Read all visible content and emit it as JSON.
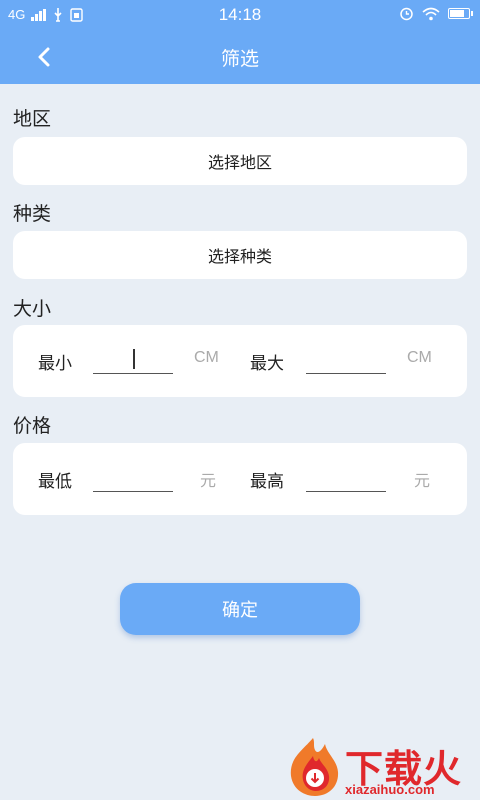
{
  "status_bar": {
    "network": "4G",
    "time": "14:18",
    "icons": [
      "signal-icon",
      "usb-icon",
      "sim-icon",
      "alarm-icon",
      "wifi-icon",
      "battery-icon"
    ]
  },
  "header": {
    "title": "筛选",
    "back_icon": "chevron-left-icon"
  },
  "region": {
    "label": "地区",
    "button": "选择地区"
  },
  "category": {
    "label": "种类",
    "button": "选择种类"
  },
  "size": {
    "label": "大小",
    "min_label": "最小",
    "max_label": "最大",
    "unit": "CM",
    "min_value": "",
    "max_value": ""
  },
  "price": {
    "label": "价格",
    "min_label": "最低",
    "max_label": "最高",
    "unit": "元",
    "min_value": "",
    "max_value": ""
  },
  "confirm": {
    "label": "确定"
  },
  "watermark": {
    "text": "下载火",
    "sub": "xiazaihuo.com"
  },
  "colors": {
    "primary": "#6aaaf6",
    "background": "#e8eef5",
    "watermark": "#e0282c"
  }
}
